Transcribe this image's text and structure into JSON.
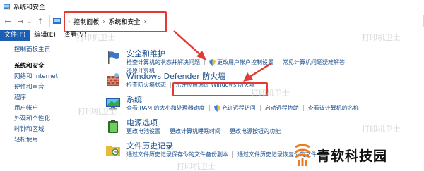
{
  "window": {
    "title": "系统和安全"
  },
  "address": {
    "crumbs": [
      "控制面板",
      "系统和安全"
    ]
  },
  "menu": [
    "文件(F)",
    "编辑(E)",
    "查看(V)"
  ],
  "sidebar": {
    "home": "控制面板主页",
    "current": "系统和安全",
    "items": [
      "网络和 Internet",
      "硬件和声音",
      "程序",
      "用户帐户",
      "外观和个性化",
      "时钟和区域",
      "轻松使用"
    ]
  },
  "sections": [
    {
      "title": "安全和维护",
      "links": [
        "检查计算机的状态并解决问题",
        "更改用户帐户控制设置",
        "常见计算机问题疑难解答"
      ],
      "row2": [
        "还原计算机"
      ]
    },
    {
      "title": "Windows Defender 防火墙",
      "links": [
        "检查防火墙状态",
        "允许应用通过 Windows 防火墙"
      ],
      "row2": []
    },
    {
      "title": "系统",
      "links": [
        "查看 RAM 的大小和处理器速度",
        "允许远程访问",
        "启动远程协助",
        "查看该计算机的名称"
      ],
      "row2": []
    },
    {
      "title": "电源选项",
      "links": [
        "更改电池设置",
        "更改计算机睡眠时间",
        "更改电源按钮的功能"
      ],
      "row2": []
    },
    {
      "title": "文件历史记录",
      "links": [
        "通过文件历史记录保存你的文件备份副本",
        "通过文件历史记录恢复你的文件"
      ],
      "row2": []
    }
  ],
  "watermark": "打印机卫士",
  "brand": "青软科技园",
  "colors": {
    "link": "#1a4e8c",
    "highlight": "#e53935",
    "menu_active": "#1a5fb4"
  }
}
